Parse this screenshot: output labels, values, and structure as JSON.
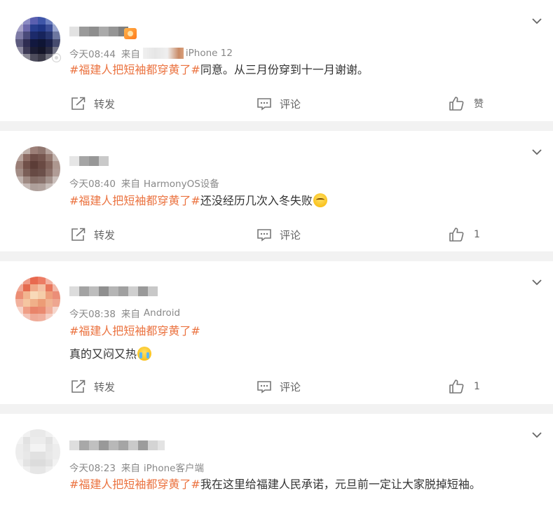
{
  "comments": [
    {
      "time": "今天08:44",
      "source_prefix": "来自",
      "source_name": "iPhone 12",
      "hashtag": "#福建人把短袖都穿黄了#",
      "body": "同意。从三月份穿到十一月谢谢。",
      "emoji": "",
      "actions": {
        "repost": "转发",
        "comment": "评论",
        "like": "赞"
      }
    },
    {
      "time": "今天08:40",
      "source_prefix": "来自",
      "source_name": "HarmonyOS设备",
      "hashtag": "#福建人把短袖都穿黄了#",
      "body": "还没经历几次入冬失败",
      "emoji": "sly-face",
      "actions": {
        "repost": "转发",
        "comment": "评论",
        "like": "1"
      }
    },
    {
      "time": "今天08:38",
      "source_prefix": "来自",
      "source_name": "Android",
      "hashtag": "#福建人把短袖都穿黄了#",
      "body": "真的又闷又热",
      "emoji": "crying-face",
      "actions": {
        "repost": "转发",
        "comment": "评论",
        "like": "1"
      }
    },
    {
      "time": "今天08:23",
      "source_prefix": "来自",
      "source_name": "iPhone客户端",
      "hashtag": "#福建人把短袖都穿黄了#",
      "body": "我在这里给福建人民承诺，元旦前一定让大家脱掉短袖。",
      "emoji": "",
      "actions": {}
    }
  ],
  "colors": {
    "hashtag": "#eb7340",
    "meta": "#888888",
    "divider": "#f2f2f2"
  },
  "icons": [
    "chevron-down-icon",
    "repost-icon",
    "comment-icon",
    "thumbs-up-icon",
    "verified-icon"
  ]
}
